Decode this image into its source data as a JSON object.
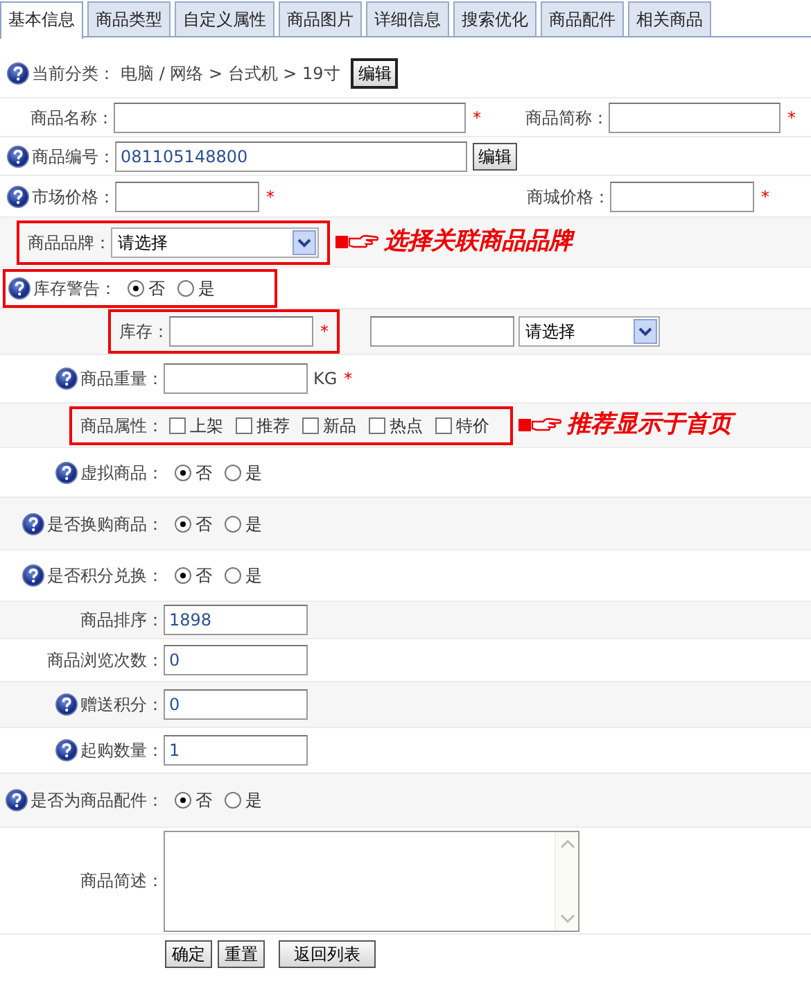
{
  "tabs": [
    {
      "label": "基本信息",
      "selected": true
    },
    {
      "label": "商品类型",
      "selected": false
    },
    {
      "label": "自定义属性",
      "selected": false
    },
    {
      "label": "商品图片",
      "selected": false
    },
    {
      "label": "详细信息",
      "selected": false
    },
    {
      "label": "搜索优化",
      "selected": false
    },
    {
      "label": "商品配件",
      "selected": false
    },
    {
      "label": "相关商品",
      "selected": false
    }
  ],
  "rows": [
    {
      "kind": "category",
      "help": true,
      "label": "当前分类：",
      "path": "电脑 / 网络 > 台式机 > 19寸",
      "button": "编辑"
    },
    {
      "kind": "pair",
      "fields": [
        {
          "label": "商品名称：",
          "required": "*"
        },
        {
          "label": "商品简称：",
          "required": "*"
        }
      ]
    },
    {
      "kind": "text",
      "help": true,
      "label": "商品编号：",
      "value": "081105148800",
      "button": "编辑"
    },
    {
      "kind": "pair",
      "help": true,
      "fields": [
        {
          "label": "市场价格：",
          "required": "*"
        },
        {
          "label": "商城价格：",
          "required": "*"
        }
      ]
    },
    {
      "kind": "select",
      "label": "商品品牌：",
      "value": "请选择",
      "highlighted": true,
      "note": "选择关联商品品牌"
    },
    {
      "kind": "radio",
      "help": true,
      "label": "库存警告：",
      "highlighted": true,
      "options": [
        {
          "label": "否",
          "selected": true
        },
        {
          "label": "是",
          "selected": false
        }
      ]
    },
    {
      "kind": "stock",
      "label": "库存：",
      "required": "*",
      "highlighted": true,
      "select": "请选择"
    },
    {
      "kind": "text",
      "help": true,
      "label": "商品重量：",
      "unit": "KG",
      "required": "*"
    },
    {
      "kind": "checks",
      "label": "商品属性：",
      "highlighted": true,
      "note": "推荐显示于首页",
      "options": [
        {
          "label": "上架",
          "checked": false
        },
        {
          "label": "推荐",
          "checked": false
        },
        {
          "label": "新品",
          "checked": false
        },
        {
          "label": "热点",
          "checked": false
        },
        {
          "label": "特价",
          "checked": false
        }
      ]
    },
    {
      "kind": "radio",
      "help": true,
      "label": "虚拟商品：",
      "options": [
        {
          "label": "否",
          "selected": true
        },
        {
          "label": "是",
          "selected": false
        }
      ]
    },
    {
      "kind": "radio",
      "help": true,
      "label": "是否换购商品：",
      "options": [
        {
          "label": "否",
          "selected": true
        },
        {
          "label": "是",
          "selected": false
        }
      ]
    },
    {
      "kind": "radio",
      "help": true,
      "label": "是否积分兑换：",
      "options": [
        {
          "label": "否",
          "selected": true
        },
        {
          "label": "是",
          "selected": false
        }
      ]
    },
    {
      "kind": "text",
      "label": "商品排序：",
      "value": "1898"
    },
    {
      "kind": "text",
      "label": "商品浏览次数：",
      "value": "0"
    },
    {
      "kind": "text",
      "help": true,
      "label": "赠送积分：",
      "value": "0"
    },
    {
      "kind": "text",
      "help": true,
      "label": "起购数量：",
      "value": "1"
    },
    {
      "kind": "radio",
      "help": true,
      "label": "是否为商品配件：",
      "options": [
        {
          "label": "否",
          "selected": true
        },
        {
          "label": "是",
          "selected": false
        }
      ]
    },
    {
      "kind": "textarea",
      "label": "商品简述："
    }
  ],
  "buttons": [
    "确定",
    "重置",
    "返回列表"
  ]
}
